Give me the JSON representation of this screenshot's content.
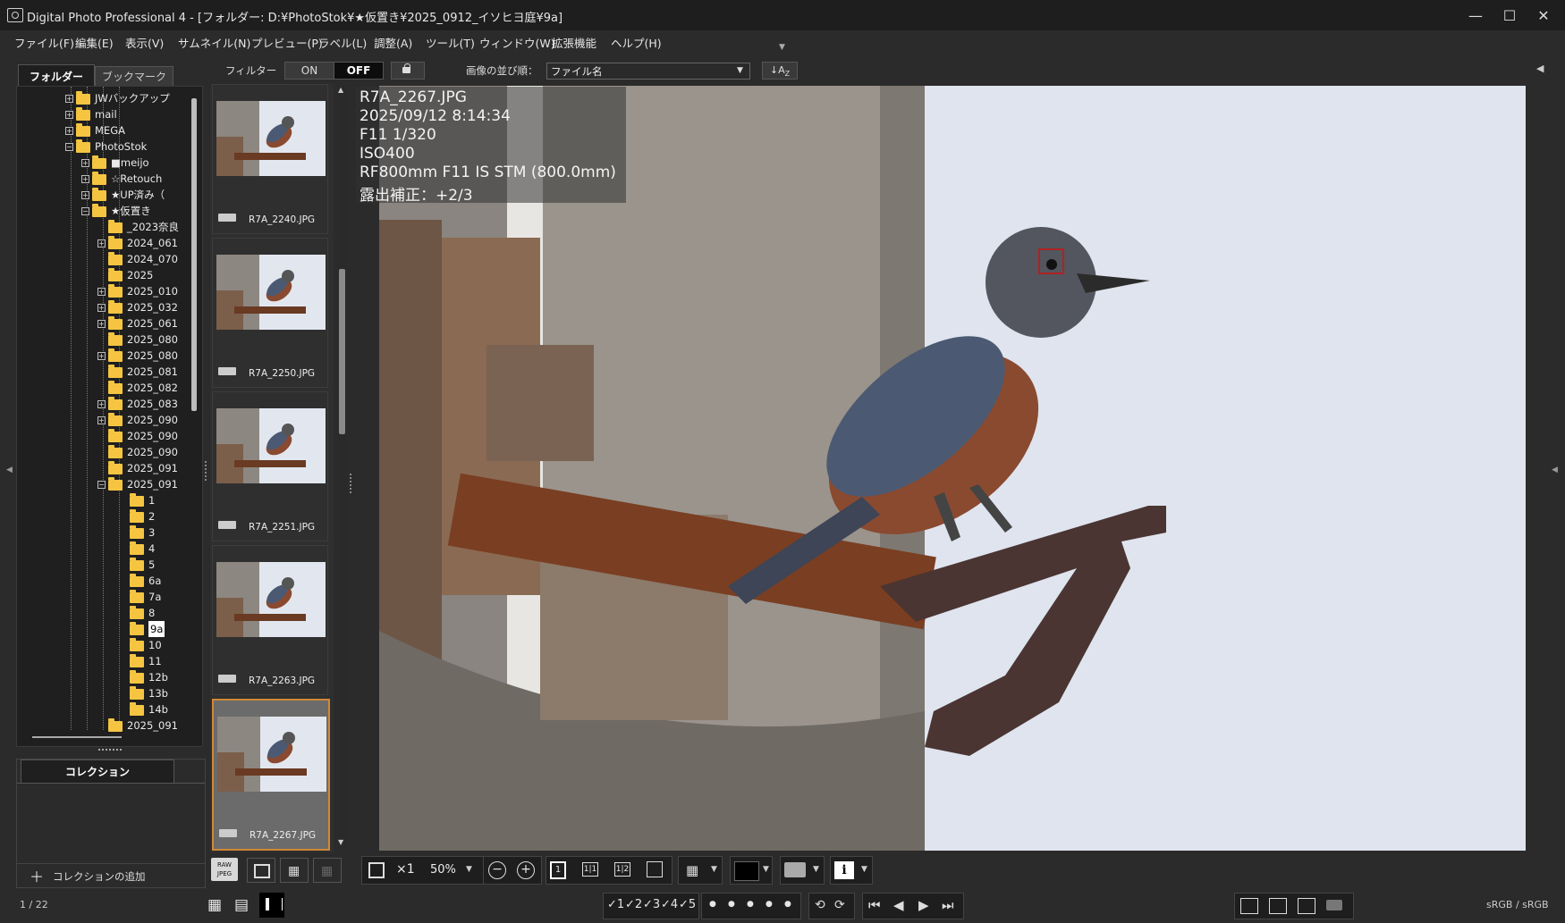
{
  "window": {
    "title": "Digital Photo Professional 4 - [フォルダー: D:¥PhotoStok¥★仮置き¥2025_0912_イソヒヨ庭¥9a]",
    "controls": [
      "—",
      "☐",
      "✕"
    ]
  },
  "menu": [
    "ファイル(F)",
    "編集(E)",
    "表示(V)",
    "サムネイル(N)",
    "プレビュー(P)",
    "ラベル(L)",
    "調整(A)",
    "ツール(T)",
    "ウィンドウ(W)",
    "拡張機能",
    "ヘルプ(H)"
  ],
  "left_panel": {
    "tabs": [
      "フォルダー",
      "ブックマーク"
    ],
    "tree": [
      {
        "label": "JWバックアップ",
        "level": 0,
        "expander": "+"
      },
      {
        "label": "mail",
        "level": 0,
        "expander": "+"
      },
      {
        "label": "MEGA",
        "level": 0,
        "expander": "+"
      },
      {
        "label": "PhotoStok",
        "level": 0,
        "expander": "−"
      },
      {
        "label": "■meijo",
        "level": 1,
        "expander": "+"
      },
      {
        "label": "☆Retouch",
        "level": 1,
        "expander": "+"
      },
      {
        "label": "★UP済み（",
        "level": 1,
        "expander": "+"
      },
      {
        "label": "★仮置き",
        "level": 1,
        "expander": "−"
      },
      {
        "label": "_2023奈良",
        "level": 2,
        "expander": ""
      },
      {
        "label": "2024_061",
        "level": 2,
        "expander": "+"
      },
      {
        "label": "2024_070",
        "level": 2,
        "expander": ""
      },
      {
        "label": "2025",
        "level": 2,
        "expander": ""
      },
      {
        "label": "2025_010",
        "level": 2,
        "expander": "+"
      },
      {
        "label": "2025_032",
        "level": 2,
        "expander": "+"
      },
      {
        "label": "2025_061",
        "level": 2,
        "expander": "+"
      },
      {
        "label": "2025_080",
        "level": 2,
        "expander": ""
      },
      {
        "label": "2025_080",
        "level": 2,
        "expander": "+"
      },
      {
        "label": "2025_081",
        "level": 2,
        "expander": ""
      },
      {
        "label": "2025_082",
        "level": 2,
        "expander": ""
      },
      {
        "label": "2025_083",
        "level": 2,
        "expander": "+"
      },
      {
        "label": "2025_090",
        "level": 2,
        "expander": "+"
      },
      {
        "label": "2025_090",
        "level": 2,
        "expander": ""
      },
      {
        "label": "2025_090",
        "level": 2,
        "expander": ""
      },
      {
        "label": "2025_091",
        "level": 2,
        "expander": ""
      },
      {
        "label": "2025_091",
        "level": 2,
        "expander": "−"
      },
      {
        "label": "1",
        "level": 3,
        "expander": ""
      },
      {
        "label": "2",
        "level": 3,
        "expander": ""
      },
      {
        "label": "3",
        "level": 3,
        "expander": ""
      },
      {
        "label": "4",
        "level": 3,
        "expander": ""
      },
      {
        "label": "5",
        "level": 3,
        "expander": ""
      },
      {
        "label": "6a",
        "level": 3,
        "expander": ""
      },
      {
        "label": "7a",
        "level": 3,
        "expander": ""
      },
      {
        "label": "8",
        "level": 3,
        "expander": ""
      },
      {
        "label": "9a",
        "level": 3,
        "expander": "",
        "selected": true
      },
      {
        "label": "10",
        "level": 3,
        "expander": ""
      },
      {
        "label": "11",
        "level": 3,
        "expander": ""
      },
      {
        "label": "12b",
        "level": 3,
        "expander": ""
      },
      {
        "label": "13b",
        "level": 3,
        "expander": ""
      },
      {
        "label": "14b",
        "level": 3,
        "expander": ""
      },
      {
        "label": "2025_091",
        "level": 2,
        "expander": ""
      }
    ],
    "collection_tab": "コレクション",
    "add_collection": "コレクションの追加",
    "add_symbol": "＋"
  },
  "toolbar": {
    "filter_label": "フィルター",
    "filter_on": "ON",
    "filter_off": "OFF",
    "sort_label": "画像の並び順：",
    "sort_value": "ファイル名",
    "sort_icon": "↓A",
    "sort_icon_sub": "Z"
  },
  "thumbnails": [
    {
      "name": "R7A_2240.JPG"
    },
    {
      "name": "R7A_2250.JPG"
    },
    {
      "name": "R7A_2251.JPG"
    },
    {
      "name": "R7A_2263.JPG"
    },
    {
      "name": "R7A_2267.JPG",
      "selected": true
    }
  ],
  "preview_info": {
    "filename": "R7A_2267.JPG",
    "datetime": "2025/09/12 8:14:34",
    "exposure": "F11 1/320",
    "iso": "ISO400",
    "lens": "RF800mm F11 IS STM (800.0mm)",
    "compensation": "露出補正：+2/3"
  },
  "preview_toolbar": {
    "zoom_x1": "×1",
    "zoom_value": "50%",
    "zoom_minus": "−",
    "zoom_plus": "+",
    "single_view": "1",
    "compare_11": "1|1",
    "compare_12": "1|2",
    "info_icon": "i"
  },
  "status": {
    "count": "1 / 22",
    "ratings": [
      "✓1",
      "✓2",
      "✓3",
      "✓4",
      "✓5"
    ],
    "dots": [
      "●",
      "●",
      "●",
      "●",
      "●"
    ],
    "color_space": "sRGB / sRGB"
  }
}
